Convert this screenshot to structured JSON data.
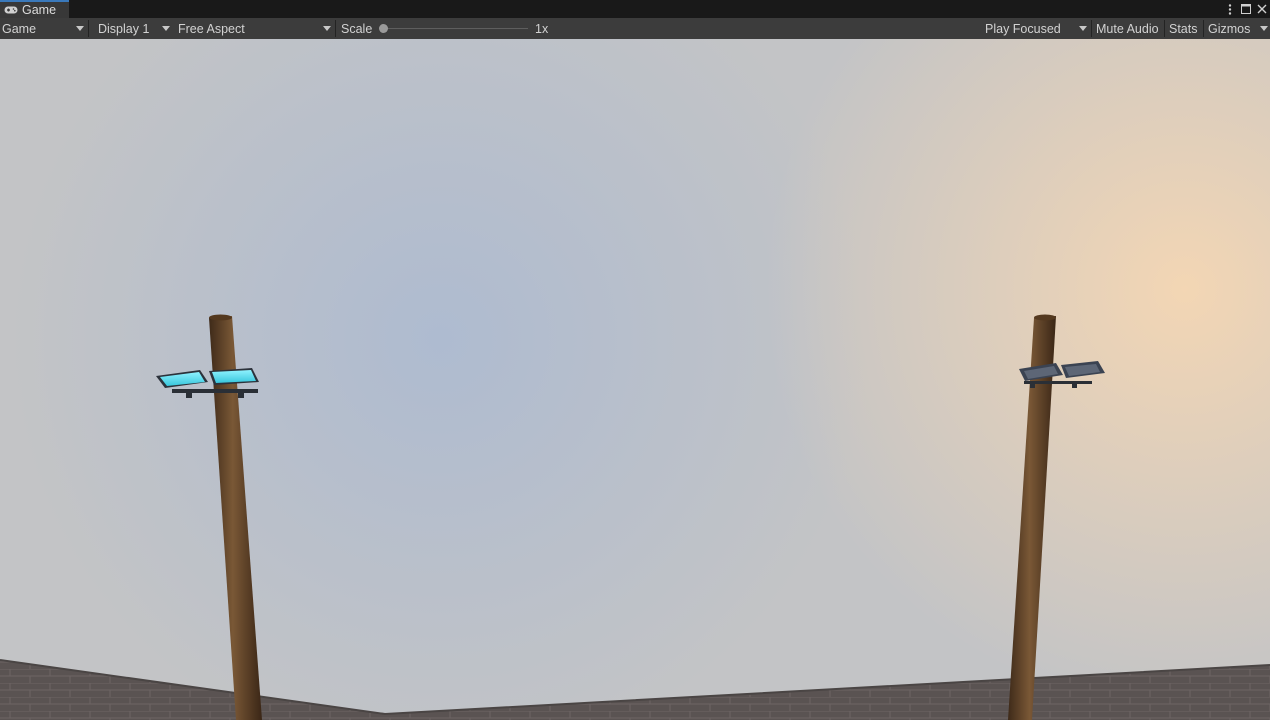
{
  "window": {
    "tab_label": "Game",
    "tab_icon": "gamepad-icon",
    "controls": [
      "more-icon",
      "maximize-icon",
      "close-icon"
    ]
  },
  "toolbar": {
    "mode": "Game",
    "display": "Display 1",
    "aspect": "Free Aspect",
    "scale_label": "Scale",
    "scale_value": "1x",
    "scale_level": 0,
    "play_mode": "Play Focused",
    "mute_audio": "Mute Audio",
    "stats": "Stats",
    "gizmos": "Gizmos"
  },
  "scene": {
    "sky_colors": [
      "#c3c4c6",
      "#aebbd0",
      "#f3d6b4"
    ],
    "ground_color": "#5a5352",
    "pole_color": "#6b4d31",
    "left_lamp_color": "#4fd8ea",
    "right_lamp_color": "#3b4352"
  }
}
